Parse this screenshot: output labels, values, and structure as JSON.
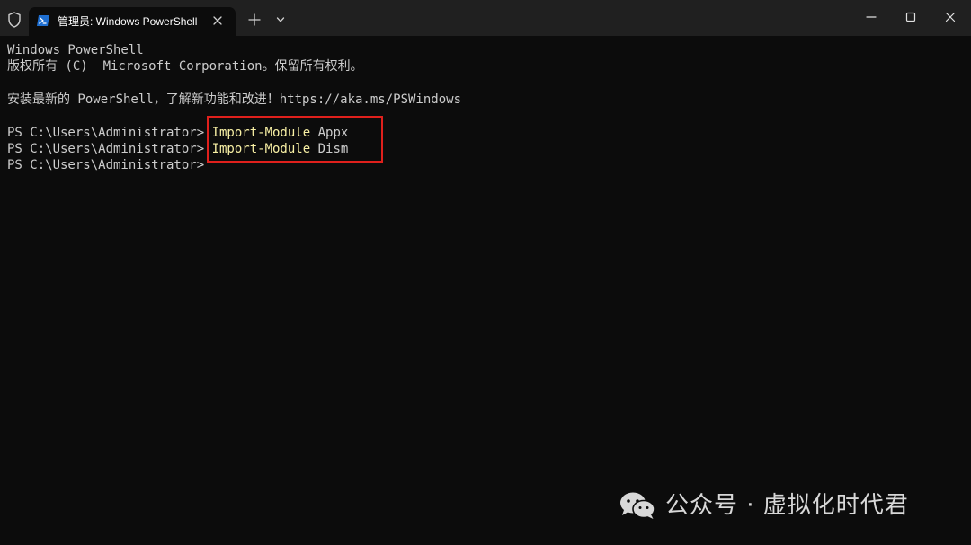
{
  "window": {
    "tab_title": "管理员: Windows PowerShell"
  },
  "icons": {
    "shield": "shield-icon",
    "tab": "powershell-icon",
    "tab_close": "close-icon",
    "new_tab": "plus-icon",
    "dropdown": "chevron-down-icon",
    "minimize": "minimize-icon",
    "maximize": "maximize-icon",
    "close": "close-icon"
  },
  "terminal": {
    "header_line1": "Windows PowerShell",
    "header_line2": "版权所有 (C)  Microsoft Corporation。保留所有权利。",
    "header_line3": "安装最新的 PowerShell，了解新功能和改进！https://aka.ms/PSWindows",
    "prompt": "PS C:\\Users\\Administrator> ",
    "commands": [
      {
        "cmd": "Import-Module",
        "arg": " Appx"
      },
      {
        "cmd": "Import-Module",
        "arg": " Dism"
      }
    ]
  },
  "watermark": {
    "text": "公众号 · 虚拟化时代君"
  },
  "colors": {
    "terminal_bg": "#0c0c0c",
    "titlebar_bg": "#202020",
    "text": "#cccccc",
    "command": "#f9f1a5",
    "highlight_box": "#e0201c"
  }
}
